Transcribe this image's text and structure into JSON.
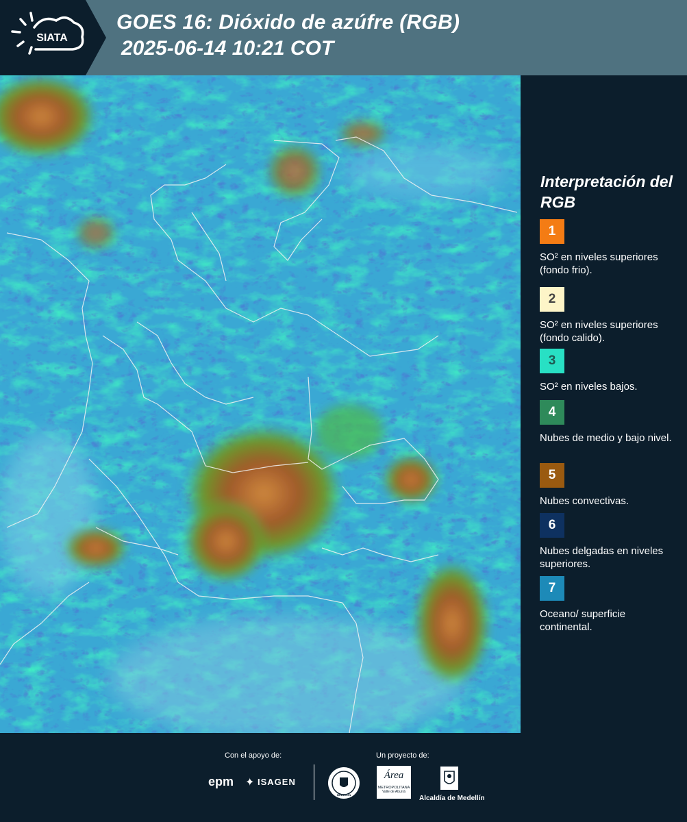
{
  "header": {
    "logo_text": "SIATA",
    "title_line1": "GOES 16: Dióxido de azúfre (RGB)",
    "title_line2": "2025-06-14 10:21 COT"
  },
  "legend": {
    "heading": "Interpretación del RGB",
    "items": [
      {
        "number": "1",
        "label": "SO² en niveles superiores (fondo frio).",
        "color": "#f47c14",
        "text_color": "#ffffff"
      },
      {
        "number": "2",
        "label": "SO² en niveles superiores (fondo calido).",
        "color": "#fdf5c8",
        "text_color": "#444444"
      },
      {
        "number": "3",
        "label": "SO² en niveles bajos.",
        "color": "#28e0c4",
        "text_color": "#1e5a52"
      },
      {
        "number": "4",
        "label": "Nubes de medio y bajo nivel.",
        "color": "#2e8a5a",
        "text_color": "#ffffff"
      },
      {
        "number": "5",
        "label": "Nubes convectivas.",
        "color": "#9a5a10",
        "text_color": "#ffffff"
      },
      {
        "number": "6",
        "label": "Nubes delgadas en niveles superiores.",
        "color": "#0e3160",
        "text_color": "#ffffff"
      },
      {
        "number": "7",
        "label": "Oceano/ superficie continental.",
        "color": "#1d8ab8",
        "text_color": "#ffffff"
      }
    ]
  },
  "footer": {
    "support_label": "Con el apoyo de:",
    "project_label": "Un proyecto de:",
    "brand_epm": "epm",
    "brand_isagen": "ISAGEN",
    "brand_area_1": "Área",
    "brand_area_2": "METROPOLITANA",
    "brand_area_3": "Valle de Aburrá",
    "brand_medellin": "Alcaldía de Medellín",
    "brand_seal": "MEDELLÍN"
  },
  "colors": {
    "header_bg": "#4f7280",
    "logo_bg": "#0c1e2c",
    "page_bg": "#0c1e2c"
  }
}
